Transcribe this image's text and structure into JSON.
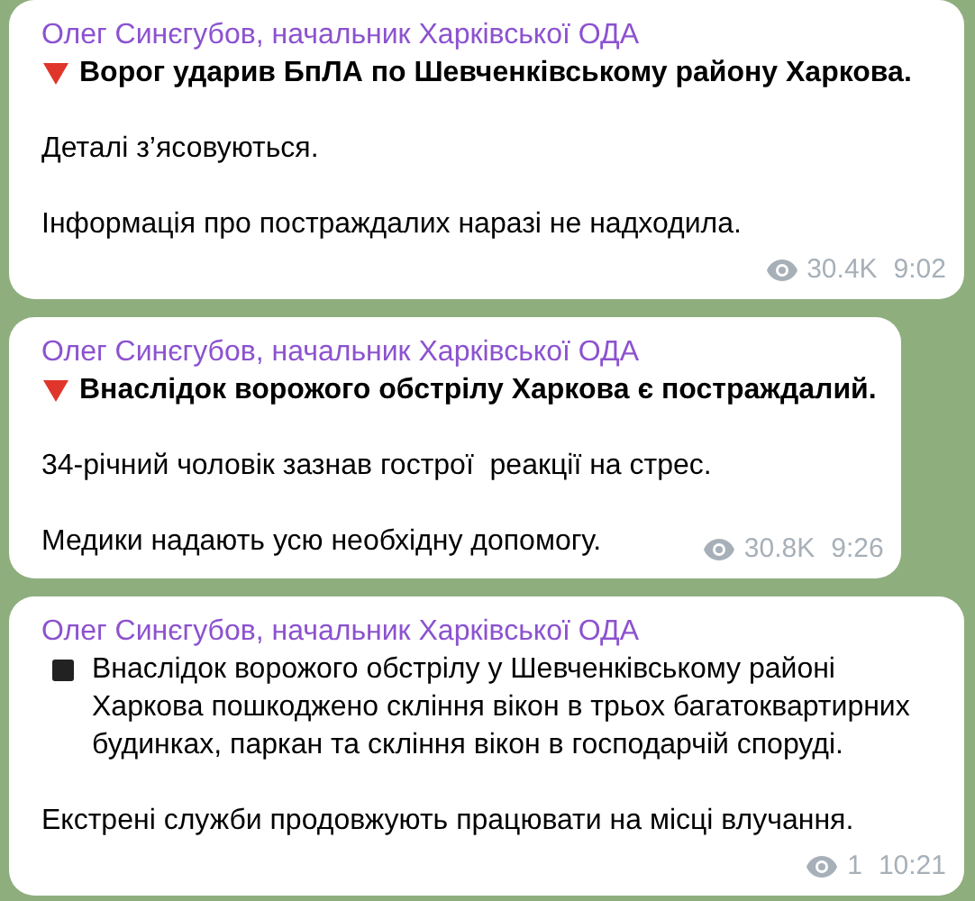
{
  "messages": [
    {
      "author": "Олег Синєгубов, начальник Харківської ОДА",
      "paragraphs": [
        {
          "kind": "alert",
          "bold": true,
          "text": "Ворог ударив БпЛА по Шевченківському району Харкова."
        },
        {
          "kind": "plain",
          "bold": false,
          "text": "Деталі з’ясовуються."
        },
        {
          "kind": "plain",
          "bold": false,
          "text": "Інформація про постраждалих наразі не надходила."
        }
      ],
      "views": "30.4K",
      "time": "9:02"
    },
    {
      "author": "Олег Синєгубов, начальник Харківської ОДА",
      "paragraphs": [
        {
          "kind": "alert",
          "bold": true,
          "text": "Внаслідок ворожого обстрілу Харкова є постраждалий."
        },
        {
          "kind": "plain",
          "bold": false,
          "text": "34-річний чоловік зазнав гострої  реакції на стрес."
        },
        {
          "kind": "plain",
          "bold": false,
          "text": "Медики надають усю необхідну допомогу."
        }
      ],
      "views": "30.8K",
      "time": "9:26"
    },
    {
      "author": "Олег Синєгубов, начальник Харківської ОДА",
      "paragraphs": [
        {
          "kind": "bullet",
          "bold": false,
          "text": "Внаслідок ворожого обстрілу у Шевченківському районі Харкова пошкоджено скління вікон в трьох багатоквартирних будинках, паркан та скління вікон в господарчій споруді."
        },
        {
          "kind": "plain",
          "bold": false,
          "text": "Екстрені служби продовжують працювати на місці влучання."
        }
      ],
      "views": "1",
      "time": "10:21"
    }
  ]
}
